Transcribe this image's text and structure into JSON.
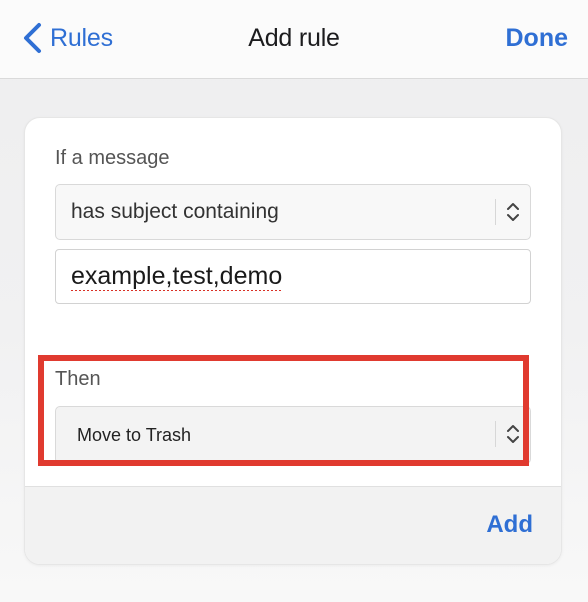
{
  "nav": {
    "back_label": "Rules",
    "title": "Add rule",
    "done_label": "Done"
  },
  "form": {
    "condition_label": "If a message",
    "condition_value": "has subject containing",
    "condition_input_value": "example,test,demo",
    "action_label": "Then",
    "action_value": "Move to Trash",
    "add_label": "Add"
  },
  "colors": {
    "accent": "#2f6fd4",
    "highlight": "#e03a2f",
    "spellcheck_underline": "#d93025"
  },
  "icons": {
    "back": "chevron-left-icon",
    "select": "chevron-up-down-icon"
  }
}
